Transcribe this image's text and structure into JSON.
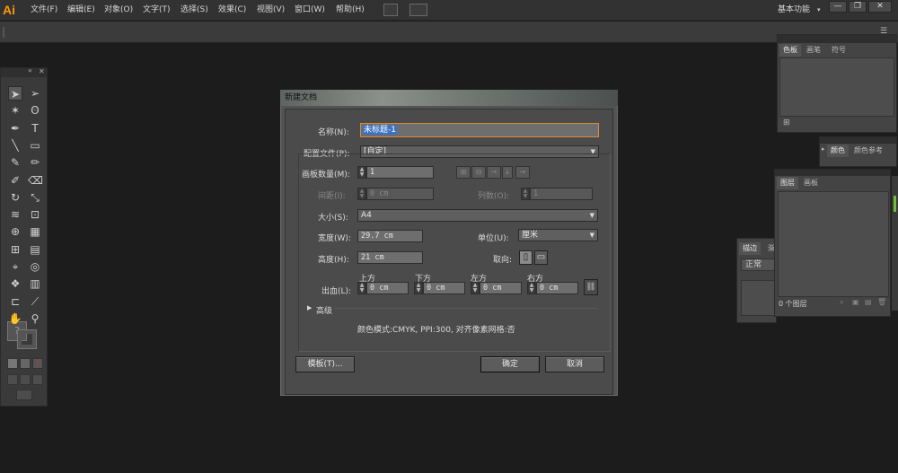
{
  "app": {
    "logo": "Ai"
  },
  "menubar": {
    "items": [
      "文件(F)",
      "编辑(E)",
      "对象(O)",
      "文字(T)",
      "选择(S)",
      "效果(C)",
      "视图(V)",
      "窗口(W)",
      "帮助(H)"
    ],
    "workspace": "基本功能",
    "window_buttons": [
      "—",
      "❐",
      "✕"
    ]
  },
  "toolbar": {
    "icons": [
      "selection-tool",
      "direct-selection-tool",
      "magic-wand-tool",
      "lasso-tool",
      "pen-tool",
      "type-tool",
      "line-tool",
      "rectangle-tool",
      "paintbrush-tool",
      "pencil-tool",
      "blob-brush-tool",
      "eraser-tool",
      "rotate-tool",
      "scale-tool",
      "warp-tool",
      "free-transform-tool",
      "shape-builder-tool",
      "perspective-grid-tool",
      "mesh-tool",
      "gradient-tool",
      "eyedropper-tool",
      "blend-tool",
      "symbol-sprayer-tool",
      "column-graph-tool",
      "artboard-tool",
      "slice-tool",
      "hand-tool",
      "zoom-tool"
    ],
    "help_glyph": "?"
  },
  "panels": {
    "swatches": {
      "tabs": [
        "色板",
        "画笔",
        "符号"
      ]
    },
    "color": {
      "tabs": [
        "颜色",
        "颜色参考"
      ]
    },
    "layers": {
      "tabs": [
        "图层",
        "画板"
      ],
      "footer": "0 个图层"
    },
    "stroke": {
      "tabs": [
        "描边",
        "渐"
      ],
      "mode": "正常"
    }
  },
  "dialog": {
    "title": "新建文档",
    "name_label": "名称(N):",
    "name_value": "未标题-1",
    "profile_label": "配置文件(P):",
    "profile_value": "[自定]",
    "artboards_label": "画板数量(M):",
    "artboards_value": "1",
    "spacing_label": "间距(I):",
    "spacing_value": "0 cm",
    "columns_label": "列数(O):",
    "columns_value": "1",
    "size_label": "大小(S):",
    "size_value": "A4",
    "width_label": "宽度(W):",
    "width_value": "29.7 cm",
    "units_label": "单位(U):",
    "units_value": "厘米",
    "height_label": "高度(H):",
    "height_value": "21 cm",
    "orientation_label": "取向:",
    "bleed_label": "出血(L):",
    "bleed_top_label": "上方",
    "bleed_bottom_label": "下方",
    "bleed_left_label": "左方",
    "bleed_right_label": "右方",
    "bleed_top": "0 cm",
    "bleed_bottom": "0 cm",
    "bleed_left": "0 cm",
    "bleed_right": "0 cm",
    "advanced_label": "高级",
    "info": "颜色模式:CMYK, PPI:300, 对齐像素网格:否",
    "templates_button": "模板(T)...",
    "ok_button": "确定",
    "cancel_button": "取消"
  }
}
